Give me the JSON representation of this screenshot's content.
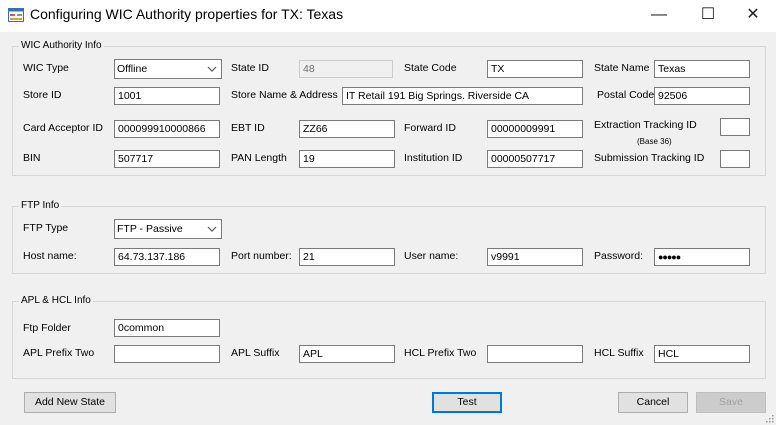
{
  "window": {
    "title": "Configuring WIC Authority properties for TX: Texas",
    "minimize": "—",
    "maximize": "☐",
    "close": "✕"
  },
  "wic": {
    "legend": "WIC Authority Info",
    "wic_type_label": "WIC Type",
    "wic_type_value": "Offline",
    "state_id_label": "State ID",
    "state_id_value": "48",
    "state_code_label": "State Code",
    "state_code_value": "TX",
    "state_name_label": "State Name",
    "state_name_value": "Texas",
    "store_id_label": "Store ID",
    "store_id_value": "1001",
    "store_name_label": "Store Name & Address",
    "store_name_value": "IT Retail 191 Big Springs. Riverside CA",
    "postal_code_label": "Postal Code",
    "postal_code_value": "92506",
    "card_acceptor_label": "Card Acceptor ID",
    "card_acceptor_value": "000099910000866",
    "ebt_id_label": "EBT ID",
    "ebt_id_value": "ZZ66",
    "forward_id_label": "Forward ID",
    "forward_id_value": "00000009991",
    "extraction_label": "Extraction Tracking ID",
    "extraction_sub": "(Base 36)",
    "extraction_value": "",
    "bin_label": "BIN",
    "bin_value": "507717",
    "pan_length_label": "PAN Length",
    "pan_length_value": "19",
    "institution_label": "Institution ID",
    "institution_value": "00000507717",
    "submission_label": "Submission Tracking ID",
    "submission_value": ""
  },
  "ftp": {
    "legend": "FTP Info",
    "type_label": "FTP Type",
    "type_value": "FTP - Passive",
    "host_label": "Host name:",
    "host_value": "64.73.137.186",
    "port_label": "Port number:",
    "port_value": "21",
    "user_label": "User name:",
    "user_value": "v9991",
    "password_label": "Password:",
    "password_value": "●●●●●"
  },
  "apl": {
    "legend": "APL & HCL Info",
    "ftp_folder_label": "Ftp Folder",
    "ftp_folder_value": "0common",
    "apl_prefix_label": "APL Prefix Two",
    "apl_prefix_value": "",
    "apl_suffix_label": "APL Suffix",
    "apl_suffix_value": "APL",
    "hcl_prefix_label": "HCL Prefix Two",
    "hcl_prefix_value": "",
    "hcl_suffix_label": "HCL Suffix",
    "hcl_suffix_value": "HCL"
  },
  "buttons": {
    "add_new_state": "Add New State",
    "test": "Test",
    "cancel": "Cancel",
    "save": "Save"
  },
  "colors": {
    "focus_border": "#0078d7",
    "disabled_text": "#a0a0a0"
  }
}
